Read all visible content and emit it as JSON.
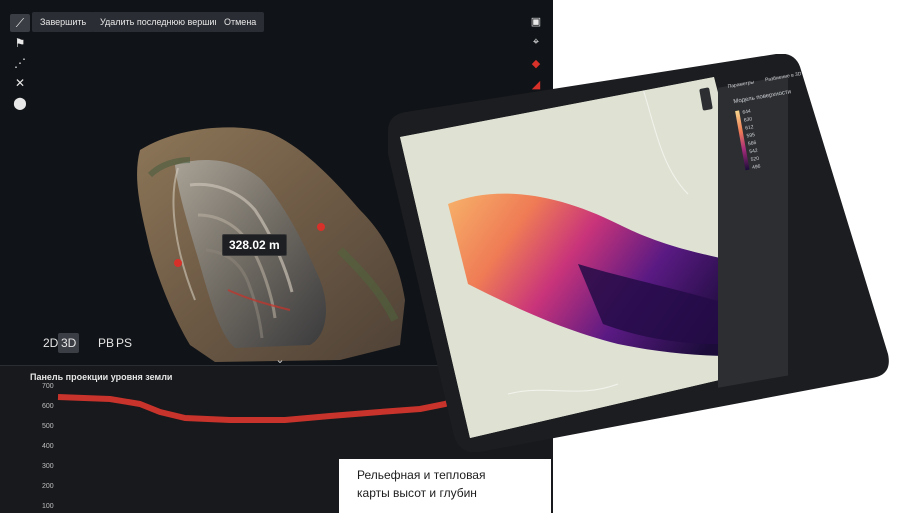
{
  "toolbar": {
    "finish_label": "Завершить",
    "delete_vertex_label": "Удалить последнюю вершину",
    "cancel_label": "Отмена"
  },
  "left_tools": [
    {
      "icon": "ruler-icon",
      "active": true
    },
    {
      "icon": "flag-icon"
    },
    {
      "icon": "polyline-icon"
    },
    {
      "icon": "expand-icon"
    },
    {
      "icon": "location-pin-icon"
    }
  ],
  "right_tools": [
    {
      "icon": "camera-icon"
    },
    {
      "icon": "focus-icon"
    },
    {
      "icon": "color-icon"
    },
    {
      "icon": "shape-icon"
    },
    {
      "icon": "layers-icon"
    }
  ],
  "viewport": {
    "measurement": "328.02 m",
    "view_modes": [
      "2D",
      "3D"
    ],
    "active_view_mode": "3D",
    "render_modes": [
      "PB",
      "PS"
    ]
  },
  "profile_panel": {
    "title": "Панель проекции уровня земли",
    "y_ticks": [
      "700",
      "600",
      "500",
      "400",
      "300",
      "200",
      "100"
    ],
    "line_color": "#c8332b"
  },
  "caption": {
    "line1": "Рельефная и тепловая",
    "line2": "карты высот и глубин"
  },
  "tablet": {
    "tabs": [
      "Параметры",
      "Разбиение в 3D"
    ],
    "panel_heading": "Модель поверхности",
    "legend_values": [
      "644",
      "630",
      "612",
      "595",
      "566",
      "542",
      "520",
      "496"
    ]
  },
  "colors": {
    "background_dark": "#0f1114",
    "heatmap_high": "#f7b26a",
    "heatmap_mid": "#c9347a",
    "heatmap_low": "#1b0c3a"
  }
}
